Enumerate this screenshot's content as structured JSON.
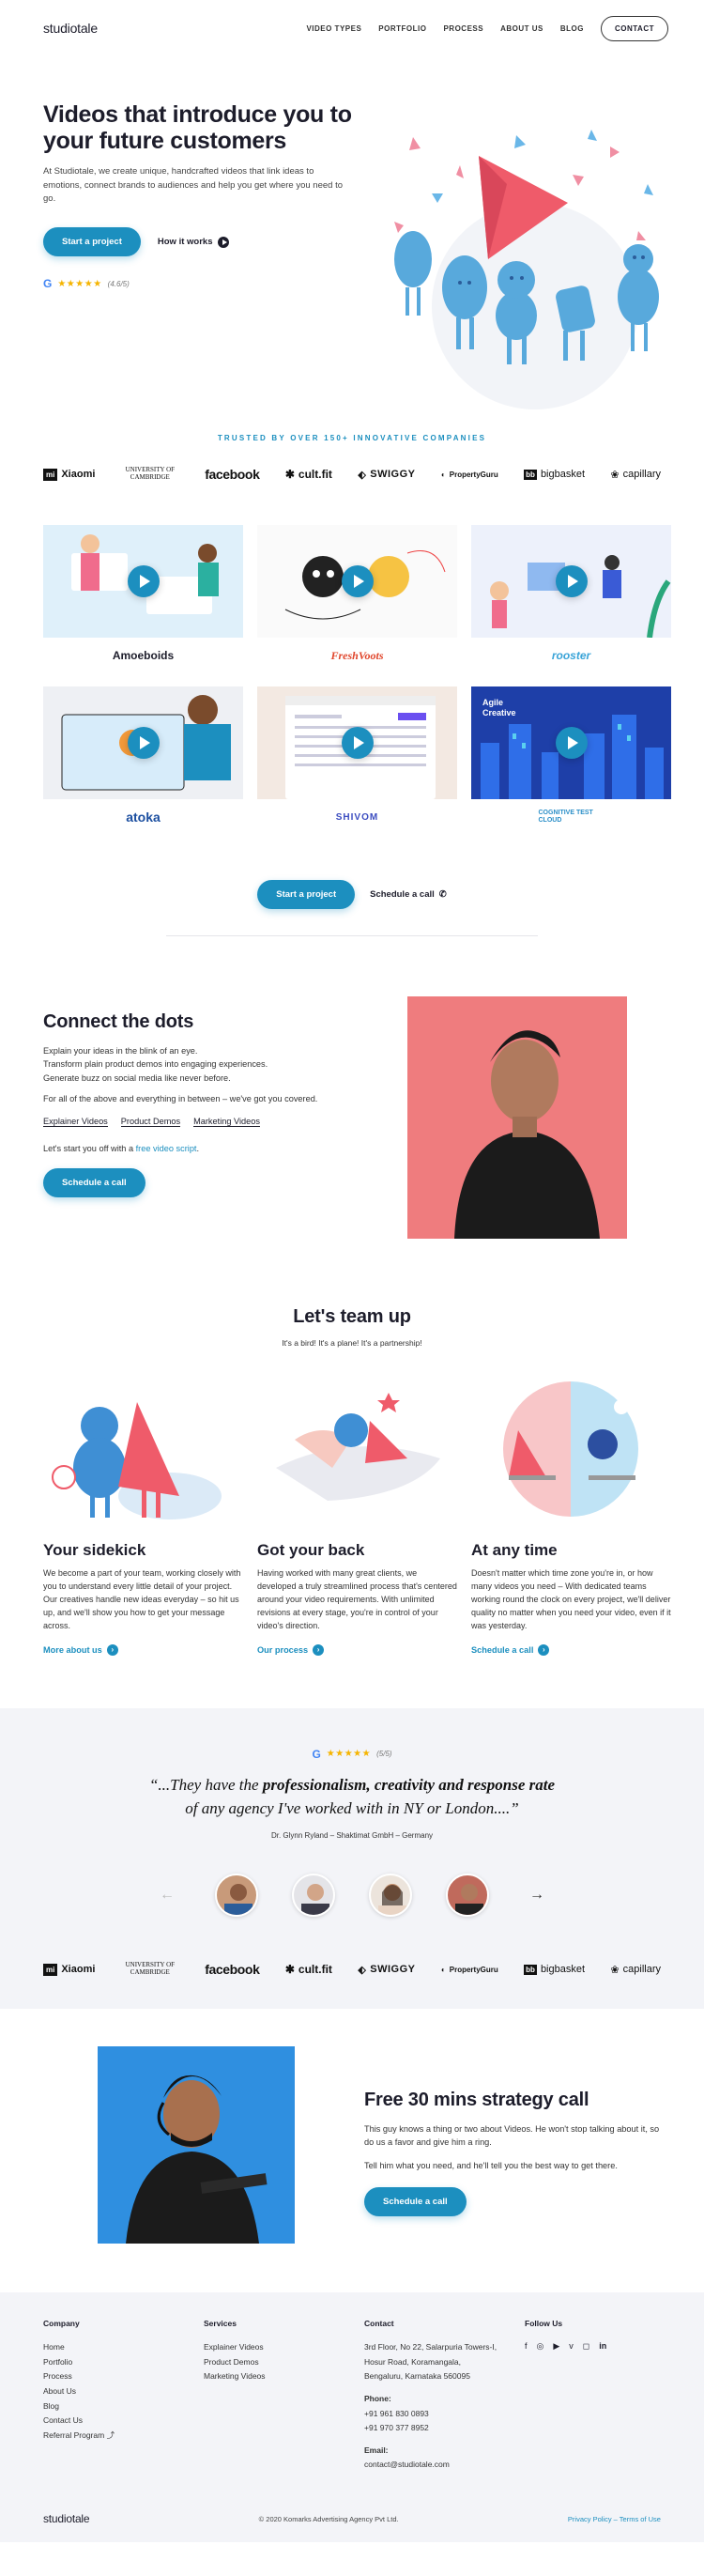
{
  "header": {
    "logo": "studiotale",
    "nav": [
      "VIDEO TYPES",
      "PORTFOLIO",
      "PROCESS",
      "ABOUT US",
      "BLOG"
    ],
    "contact": "CONTACT"
  },
  "hero": {
    "title": "Videos that introduce you to your future customers",
    "description": "At Studiotale, we create unique, handcrafted videos that link ideas to emotions, connect brands to audiences and help you get where you need to go.",
    "cta_primary": "Start a project",
    "cta_secondary": "How it works",
    "rating_icon": "G",
    "rating": "(4.6/5)",
    "stars": "★★★★★"
  },
  "trusted": {
    "heading": "TRUSTED BY OVER 150+ INNOVATIVE COMPANIES",
    "logos": [
      "Xiaomi",
      "UNIVERSITY OF CAMBRIDGE",
      "facebook",
      "cult.fit",
      "SWIGGY",
      "PropertyGuru",
      "bigbasket",
      "capillary"
    ]
  },
  "portfolio": {
    "clients": [
      "Amoeboids",
      "FreshVoots",
      "rooster",
      "atoka",
      "SHIVOM",
      "COGNITIVE TEST CLOUD"
    ],
    "thumb_text": "Agile Creative"
  },
  "mid_cta": {
    "primary": "Start a project",
    "secondary": "Schedule a call"
  },
  "connect": {
    "title": "Connect the dots",
    "para1_line1": "Explain your ideas in the blink of an eye.",
    "para1_line2": "Transform plain product demos into engaging experiences.",
    "para1_line3": "Generate buzz on social media like never before.",
    "para2": "For all of the above and everything in between – we've got you covered.",
    "links": [
      "Explainer Videos",
      "Product Demos",
      "Marketing Videos"
    ],
    "offer_prefix": "Let's start you off with a ",
    "offer_link": "free video script",
    "offer_suffix": ".",
    "button": "Schedule a call"
  },
  "team": {
    "title": "Let's team up",
    "subtitle": "It's a bird! It's a plane! It's a partnership!",
    "columns": [
      {
        "title": "Your sidekick",
        "text": "We become a part of your team, working closely with you to understand every little detail of your project. Our creatives handle new ideas everyday – so hit us up, and we'll show you how to get your message across.",
        "link": "More about us"
      },
      {
        "title": "Got your back",
        "text": "Having worked with many great clients, we developed a truly streamlined process that's centered around your video requirements. With unlimited revisions at every stage, you're in control of your video's direction.",
        "link": "Our process"
      },
      {
        "title": "At any time",
        "text": "Doesn't matter which time zone you're in, or how many videos you need – With dedicated teams working round the clock on every project, we'll deliver quality no matter when you need your video, even if it was yesterday.",
        "link": "Schedule a call"
      }
    ]
  },
  "testimonial": {
    "rating": "(5/5)",
    "stars": "★★★★★",
    "quote_open": "“...They have the ",
    "quote_bold": "professionalism, creativity and response rate",
    "quote_rest": " of any agency I've worked with in NY or London....”",
    "author": "Dr. Glynn Ryland – Shaktimat GmbH – Germany",
    "prev": "←",
    "next": "→"
  },
  "strategy": {
    "title": "Free 30 mins strategy call",
    "text1": "This guy knows a thing or two about Videos. He won't stop talking about it, so do us a favor and give him a ring.",
    "text2": "Tell him what you need, and he'll tell you the best way to get there.",
    "button": "Schedule a call"
  },
  "footer": {
    "company": {
      "title": "Company",
      "items": [
        "Home",
        "Portfolio",
        "Process",
        "About Us",
        "Blog",
        "Contact Us",
        "Referral Program"
      ]
    },
    "services": {
      "title": "Services",
      "items": [
        "Explainer Videos",
        "Product Demos",
        "Marketing Videos"
      ]
    },
    "contact": {
      "title": "Contact",
      "address": [
        "3rd Floor, No 22, Salarpuria Towers-I,",
        "Hosur Road, Koramangala,",
        "Bengaluru, Karnataka 560095"
      ],
      "phone_label": "Phone:",
      "phones": [
        "+91 961 830 0893",
        "+91 970 377 8952"
      ],
      "email_label": "Email:",
      "email": "contact@studiotale.com"
    },
    "follow": {
      "title": "Follow Us",
      "icons": [
        "f",
        "◎",
        "▶",
        "v",
        "◻",
        "in"
      ]
    },
    "logo": "studiotale",
    "copyright": "© 2020 Komarks Advertising Agency Pvt Ltd.",
    "legal": "Privacy Policy – Terms of Use"
  },
  "colors": {
    "accent": "#1c8fbf",
    "text": "#1d1d2b",
    "soft_bg": "#f3f4f8",
    "coral": "#ef7c7e"
  }
}
